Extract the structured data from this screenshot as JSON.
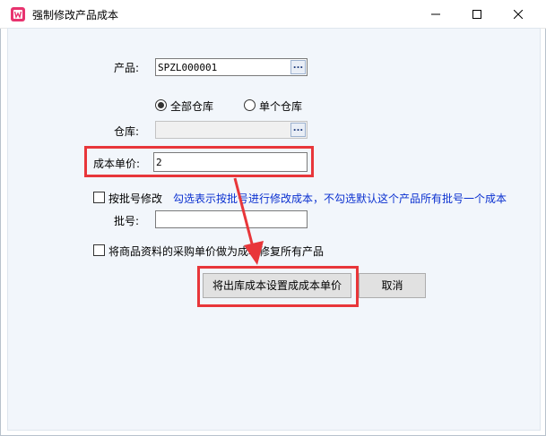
{
  "window": {
    "title": "强制修改产品成本",
    "icon": "app-logo-icon",
    "minimize_icon": "minimize-icon",
    "maximize_icon": "maximize-icon",
    "close_icon": "close-icon"
  },
  "form": {
    "product_label": "产品:",
    "product_value": "SPZL000001",
    "browse_label": "...",
    "radio_all_label": "全部仓库",
    "radio_single_label": "单个仓库",
    "radio_selected": "all",
    "warehouse_label": "仓库:",
    "warehouse_value": "",
    "unit_cost_label": "成本单价:",
    "unit_cost_value": "2",
    "batch_modify_label": "按批号修改",
    "batch_modify_checked": false,
    "batch_hint": "勾选表示按批号进行修改成本，不勾选默认这个产品所有批号一个成本",
    "batch_no_label": "批号:",
    "batch_no_value": "",
    "use_purchase_price_label": "将商品资料的采购单价做为成本修复所有产品",
    "use_purchase_price_checked": false
  },
  "buttons": {
    "set_cost_label": "将出库成本设置成成本单价",
    "cancel_label": "取消"
  },
  "annotation": {
    "highlight_color": "#e8363a",
    "hint_color": "#0a30d0"
  }
}
